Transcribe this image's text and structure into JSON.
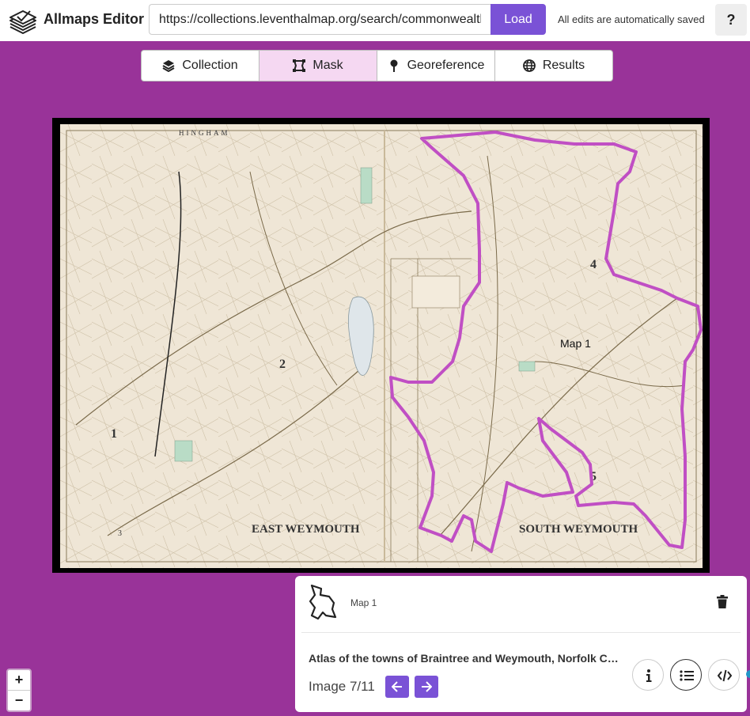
{
  "header": {
    "brand": "Allmaps Editor",
    "url_value": "https://collections.leventhalmap.org/search/commonwealth:",
    "load_label": "Load",
    "save_status": "All edits are automatically saved",
    "help_label": "?"
  },
  "tabs": [
    {
      "label": "Collection",
      "icon": "layers-icon",
      "active": false
    },
    {
      "label": "Mask",
      "icon": "mask-icon",
      "active": true
    },
    {
      "label": "Georeference",
      "icon": "pin-icon",
      "active": false
    },
    {
      "label": "Results",
      "icon": "globe-icon",
      "active": false
    }
  ],
  "map": {
    "mask_label": "Map 1",
    "printed_labels": [
      "HINGHAM",
      "EAST WEYMOUTH",
      "SOUTH WEYMOUTH",
      "1",
      "2",
      "3",
      "4",
      "5"
    ],
    "mask_color": "#c04fc4"
  },
  "zoom": {
    "in": "+",
    "out": "−"
  },
  "panel": {
    "map_name": "Map 1",
    "title": "Atlas of the towns of Braintree and Weymouth, Norfolk County, Massachusetts",
    "image_count": "Image 7/11"
  },
  "colors": {
    "background": "#993399",
    "accent": "#7a52d6",
    "active_tab": "#f5d8f2"
  }
}
